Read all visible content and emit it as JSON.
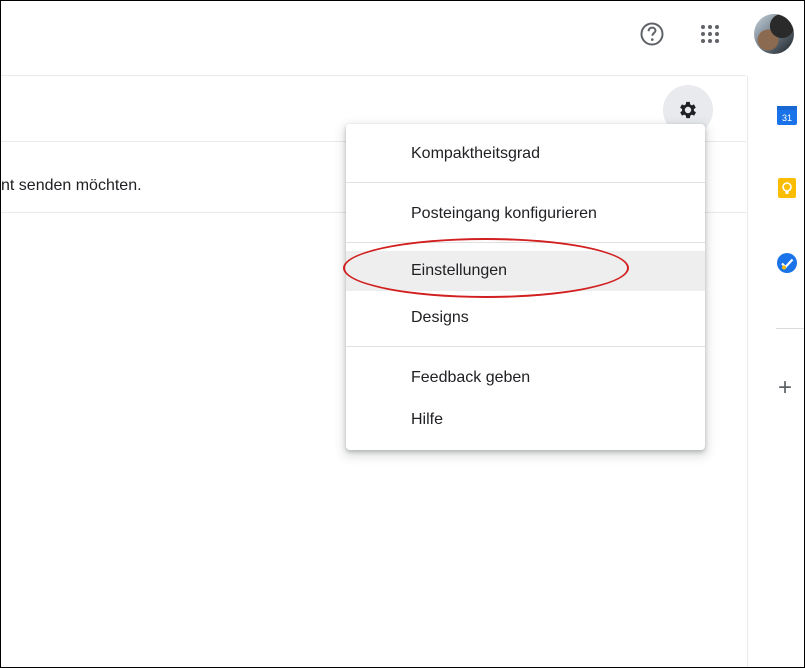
{
  "header": {
    "help_icon": "help-circle-icon",
    "apps_icon": "apps-grid-icon",
    "avatar_icon": "account-avatar"
  },
  "toolbar": {
    "settings_icon": "gear-icon"
  },
  "main": {
    "partial_text": "nt senden möchten."
  },
  "settings_menu": {
    "items": [
      {
        "label": "Kompaktheitsgrad"
      },
      {
        "label": "Posteingang konfigurieren"
      },
      {
        "label": "Einstellungen",
        "selected": true
      },
      {
        "label": "Designs"
      },
      {
        "label": "Feedback geben"
      },
      {
        "label": "Hilfe"
      }
    ]
  },
  "side_panel": {
    "items": [
      {
        "icon": "calendar-icon",
        "text": "31"
      },
      {
        "icon": "keep-icon"
      },
      {
        "icon": "tasks-icon"
      },
      {
        "icon": "add-icon",
        "text": "+"
      }
    ]
  },
  "colors": {
    "calendar_blue": "#1a73e8",
    "keep_yellow": "#fbbc04",
    "tasks_blue": "#1a73e8",
    "annotation_red": "#d21f1f"
  }
}
